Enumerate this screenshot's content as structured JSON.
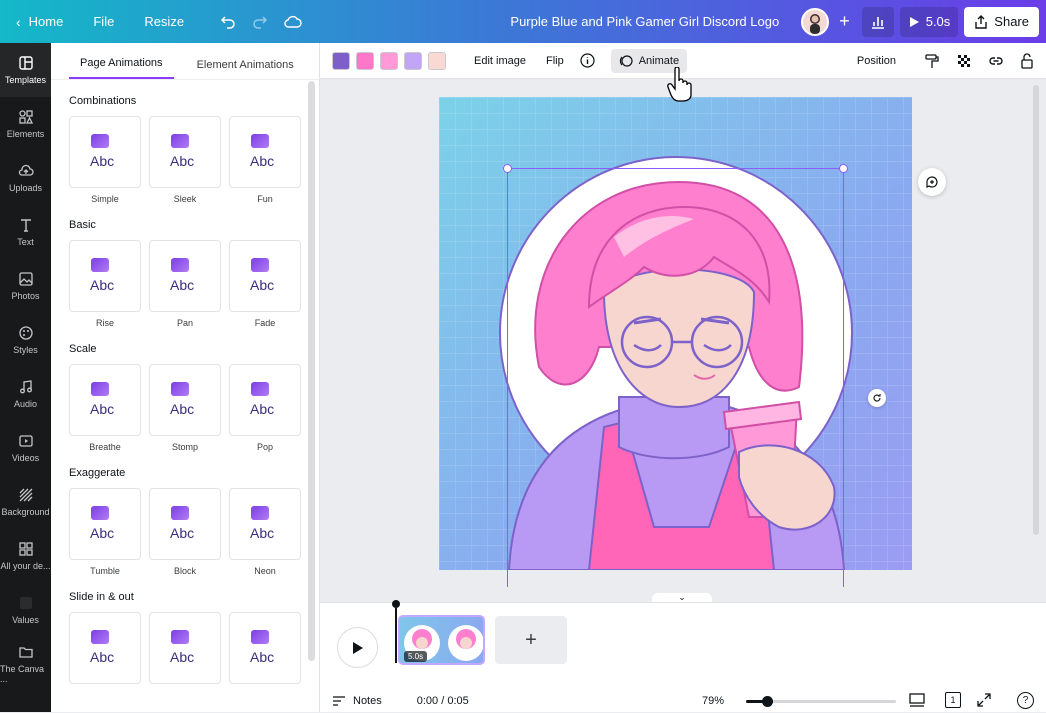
{
  "topbar": {
    "home_label": "Home",
    "file_label": "File",
    "resize_label": "Resize",
    "doc_title": "Purple Blue and Pink Gamer Girl Discord Logo",
    "play_duration": "5.0s",
    "share_label": "Share"
  },
  "rail": {
    "items": [
      {
        "label": "Templates",
        "icon": "templates-icon"
      },
      {
        "label": "Elements",
        "icon": "elements-icon"
      },
      {
        "label": "Uploads",
        "icon": "uploads-icon"
      },
      {
        "label": "Text",
        "icon": "text-icon"
      },
      {
        "label": "Photos",
        "icon": "photos-icon"
      },
      {
        "label": "Styles",
        "icon": "styles-icon"
      },
      {
        "label": "Audio",
        "icon": "audio-icon"
      },
      {
        "label": "Videos",
        "icon": "videos-icon"
      },
      {
        "label": "Background",
        "icon": "background-icon"
      },
      {
        "label": "All your de...",
        "icon": "all-designs-icon"
      },
      {
        "label": "Values",
        "icon": "values-icon"
      },
      {
        "label": "The Canva ...",
        "icon": "folder-icon"
      }
    ]
  },
  "panel": {
    "tab_page": "Page Animations",
    "tab_element": "Element Animations",
    "sections": [
      {
        "title": "Combinations",
        "items": [
          "Simple",
          "Sleek",
          "Fun"
        ]
      },
      {
        "title": "Basic",
        "items": [
          "Rise",
          "Pan",
          "Fade"
        ]
      },
      {
        "title": "Scale",
        "items": [
          "Breathe",
          "Stomp",
          "Pop"
        ]
      },
      {
        "title": "Exaggerate",
        "items": [
          "Tumble",
          "Block",
          "Neon"
        ]
      },
      {
        "title": "Slide in & out",
        "items": [
          "",
          "",
          ""
        ]
      }
    ],
    "thumb_text": "Abc"
  },
  "toolbar": {
    "colors": [
      "#7e5ec8",
      "#ff77c8",
      "#ff99d8",
      "#c2a5f5",
      "#fad9d5"
    ],
    "edit_image": "Edit image",
    "flip": "Flip",
    "animate": "Animate",
    "position": "Position"
  },
  "timeline": {
    "clip_duration": "5.0s",
    "add_symbol": "+",
    "notes": "Notes",
    "time": "0:00 / 0:05",
    "zoom": "79%",
    "zoom_level": 0.14,
    "page_count": "1"
  }
}
